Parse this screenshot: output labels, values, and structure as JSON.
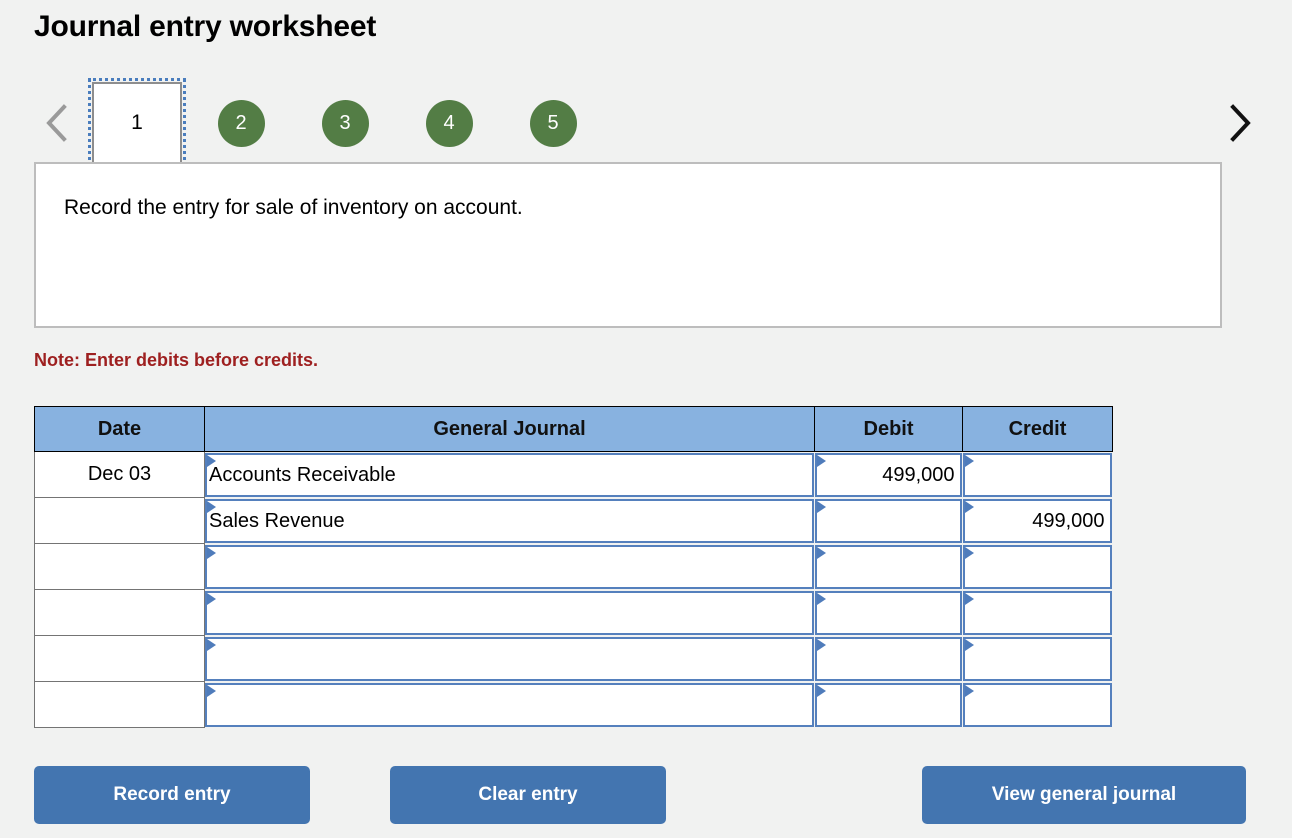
{
  "page": {
    "title": "Journal entry worksheet",
    "background_color": "#f1f2f1"
  },
  "pager": {
    "prev_icon": "chevron-left-icon",
    "next_icon": "chevron-right-icon",
    "prev_enabled": false,
    "next_enabled": true,
    "active_tab": "1",
    "accent_green": "#537d45",
    "tabs": [
      {
        "label": "1",
        "active": true
      },
      {
        "label": "2",
        "active": false
      },
      {
        "label": "3",
        "active": false
      },
      {
        "label": "4",
        "active": false
      },
      {
        "label": "5",
        "active": false
      }
    ]
  },
  "instruction": {
    "text": "Record the entry for sale of inventory on account."
  },
  "note": {
    "text": "Note: Enter debits before credits.",
    "color": "#9e2020"
  },
  "table": {
    "header_color": "#88b2e0",
    "columns": [
      "Date",
      "General Journal",
      "Debit",
      "Credit"
    ],
    "rows": [
      {
        "date": "Dec 03",
        "account": "Accounts Receivable",
        "debit": "499,000",
        "credit": ""
      },
      {
        "date": "",
        "account": "Sales Revenue",
        "debit": "",
        "credit": "499,000"
      },
      {
        "date": "",
        "account": "",
        "debit": "",
        "credit": ""
      },
      {
        "date": "",
        "account": "",
        "debit": "",
        "credit": ""
      },
      {
        "date": "",
        "account": "",
        "debit": "",
        "credit": ""
      },
      {
        "date": "",
        "account": "",
        "debit": "",
        "credit": ""
      }
    ]
  },
  "buttons": {
    "record": "Record entry",
    "clear": "Clear entry",
    "view": "View general journal",
    "color": "#4375b0"
  }
}
